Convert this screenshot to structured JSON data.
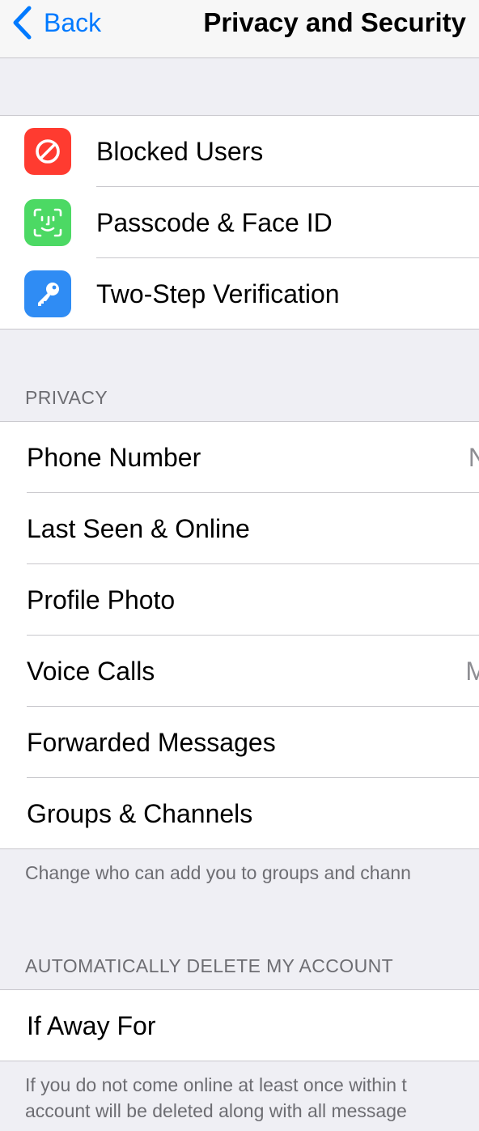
{
  "nav": {
    "back_label": "Back",
    "title": "Privacy and Security"
  },
  "security_items": [
    {
      "label": "Blocked Users",
      "icon": "block-icon",
      "color": "#ff3b30"
    },
    {
      "label": "Passcode & Face ID",
      "icon": "face-id-icon",
      "color": "#4cd964"
    },
    {
      "label": "Two-Step Verification",
      "icon": "key-icon",
      "color": "#2f8cf4"
    }
  ],
  "privacy": {
    "header": "PRIVACY",
    "items": [
      {
        "label": "Phone Number",
        "value": "N"
      },
      {
        "label": "Last Seen & Online",
        "value": ""
      },
      {
        "label": "Profile Photo",
        "value": ""
      },
      {
        "label": "Voice Calls",
        "value": "M"
      },
      {
        "label": "Forwarded Messages",
        "value": ""
      },
      {
        "label": "Groups & Channels",
        "value": ""
      }
    ],
    "footer": "Change who can add you to groups and chann"
  },
  "delete_account": {
    "header": "AUTOMATICALLY DELETE MY ACCOUNT",
    "item": {
      "label": "If Away For"
    },
    "footer_line1": "If you do not come online at least once within t",
    "footer_line2": "account will be deleted along with all message"
  },
  "colors": {
    "accent": "#007aff",
    "background": "#efeff4",
    "separator": "#c8c7cc",
    "secondary_text": "#6d6d72"
  }
}
